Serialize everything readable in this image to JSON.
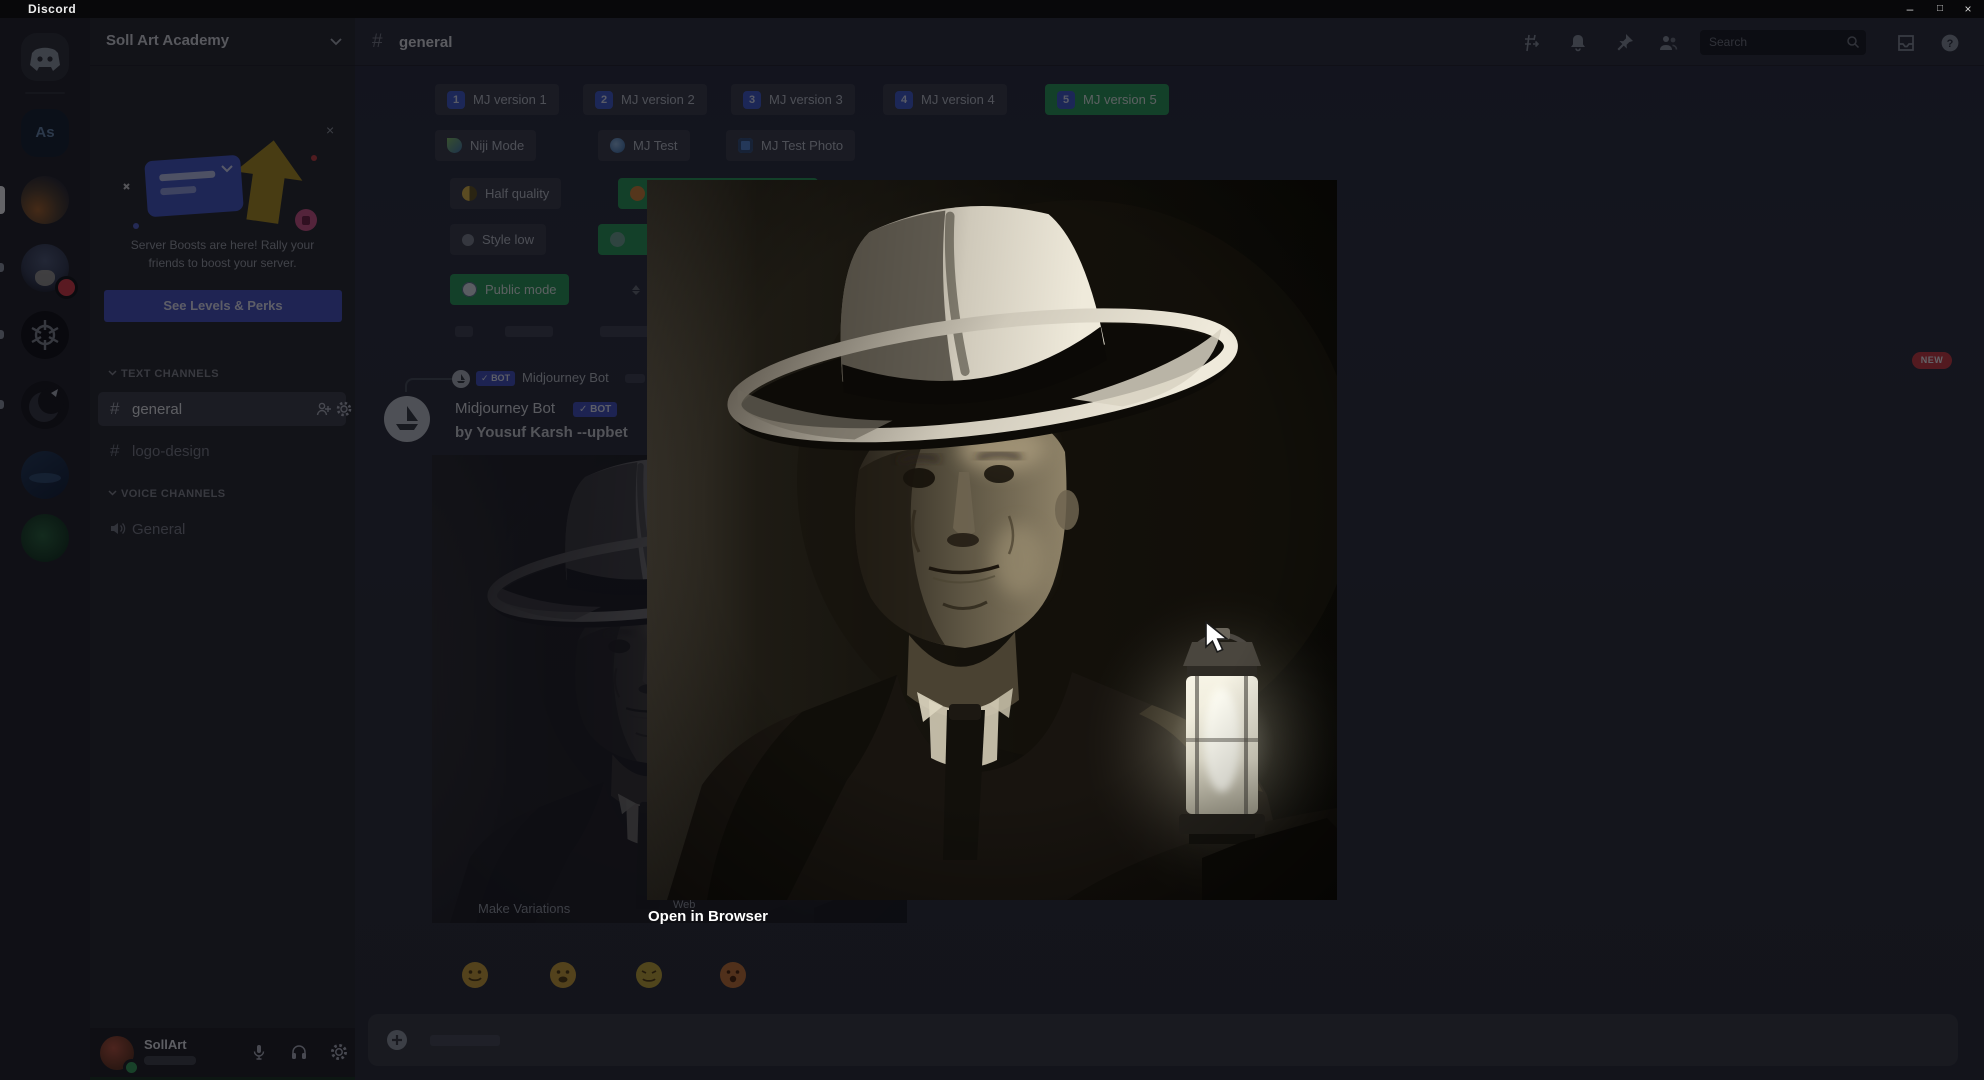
{
  "window": {
    "app_name": "Discord",
    "minimize": "–",
    "maximize": "□",
    "close": "×"
  },
  "icons": {
    "hash": "#"
  },
  "rail": {
    "as_label": "As"
  },
  "sidebar": {
    "server_name": "Soll Art Academy",
    "boost_card": {
      "close": "×",
      "line1": "Server Boosts are here! Rally your",
      "line2": "friends to boost your server.",
      "cta": "See Levels & Perks"
    },
    "text_channels_label": "TEXT CHANNELS",
    "channels": [
      {
        "name": "general"
      },
      {
        "name": "logo-design"
      }
    ],
    "voice_channels_label": "VOICE CHANNELS",
    "voice_channels": [
      {
        "name": "General"
      }
    ],
    "user": {
      "name": "SollArt"
    }
  },
  "channel_header": {
    "name": "general",
    "search_placeholder": "Search"
  },
  "mj": {
    "row1": [
      {
        "key": "1",
        "label": "MJ version 1"
      },
      {
        "key": "2",
        "label": "MJ version 2"
      },
      {
        "key": "3",
        "label": "MJ version 3"
      },
      {
        "key": "4",
        "label": "MJ version 4"
      },
      {
        "key": "5",
        "label": "MJ version 5"
      }
    ],
    "row2": [
      "Niji Mode",
      "MJ Test",
      "MJ Test Photo"
    ],
    "row3": [
      "Half quality"
    ],
    "row4": [
      "Style low"
    ],
    "row5": [
      "Public mode"
    ]
  },
  "message": {
    "reply_author": "Midjourney Bot",
    "bot_check": "✓",
    "bot_badge": "BOT",
    "author": "Midjourney Bot",
    "content": "by Yousuf Karsh --upbet",
    "variations_label": "Make Variations",
    "web_label": "Web",
    "new_badge": "NEW"
  },
  "lightbox": {
    "open_link": "Open in Browser"
  },
  "colors": {
    "accent_green": "#2ea35c",
    "blurple": "#5865f2",
    "badge_red": "#d64045"
  }
}
